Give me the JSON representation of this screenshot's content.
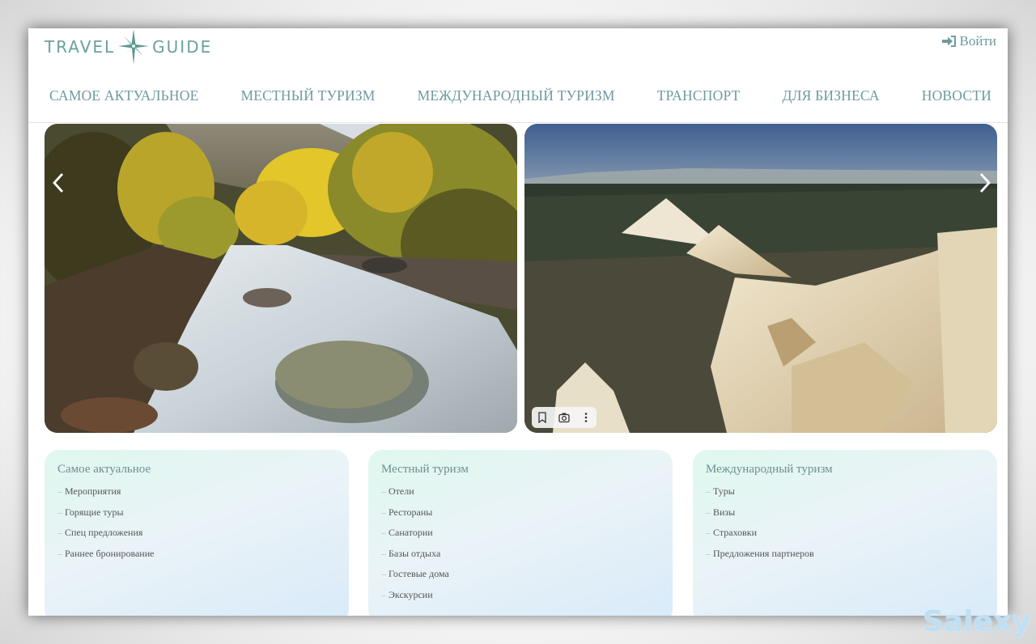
{
  "header": {
    "logo_left": "TRAVEL",
    "logo_right": "GUIDE",
    "login_label": "Войти"
  },
  "nav": {
    "items": [
      {
        "label": "САМОЕ АКТУАЛЬНОЕ"
      },
      {
        "label": "МЕСТНЫЙ ТУРИЗМ"
      },
      {
        "label": "МЕЖДУНАРОДНЫЙ ТУРИЗМ"
      },
      {
        "label": "ТРАНСПОРТ"
      },
      {
        "label": "ДЛЯ БИЗНЕСА"
      },
      {
        "label": "НОВОСТИ"
      }
    ]
  },
  "carousel": {
    "icons": [
      "chevron-left-icon",
      "chevron-right-icon",
      "bookmark-icon",
      "camera-icon",
      "more-vertical-icon"
    ]
  },
  "cards": [
    {
      "title": "Самое актуальное",
      "items": [
        "Мероприятия",
        "Горящие туры",
        "Спец предложения",
        "Раннее бронирование"
      ]
    },
    {
      "title": "Местный туризм",
      "items": [
        "Отели",
        "Рестораны",
        "Санатории",
        "Базы отдыха",
        "Гостевые дома",
        "Экскурсии"
      ]
    },
    {
      "title": "Международный туризм",
      "items": [
        "Туры",
        "Визы",
        "Страховки",
        "Предложения партнеров"
      ]
    }
  ],
  "watermark": "Salexy",
  "colors": {
    "accent": "#6d9aa0",
    "logo": "#6aa19c"
  }
}
